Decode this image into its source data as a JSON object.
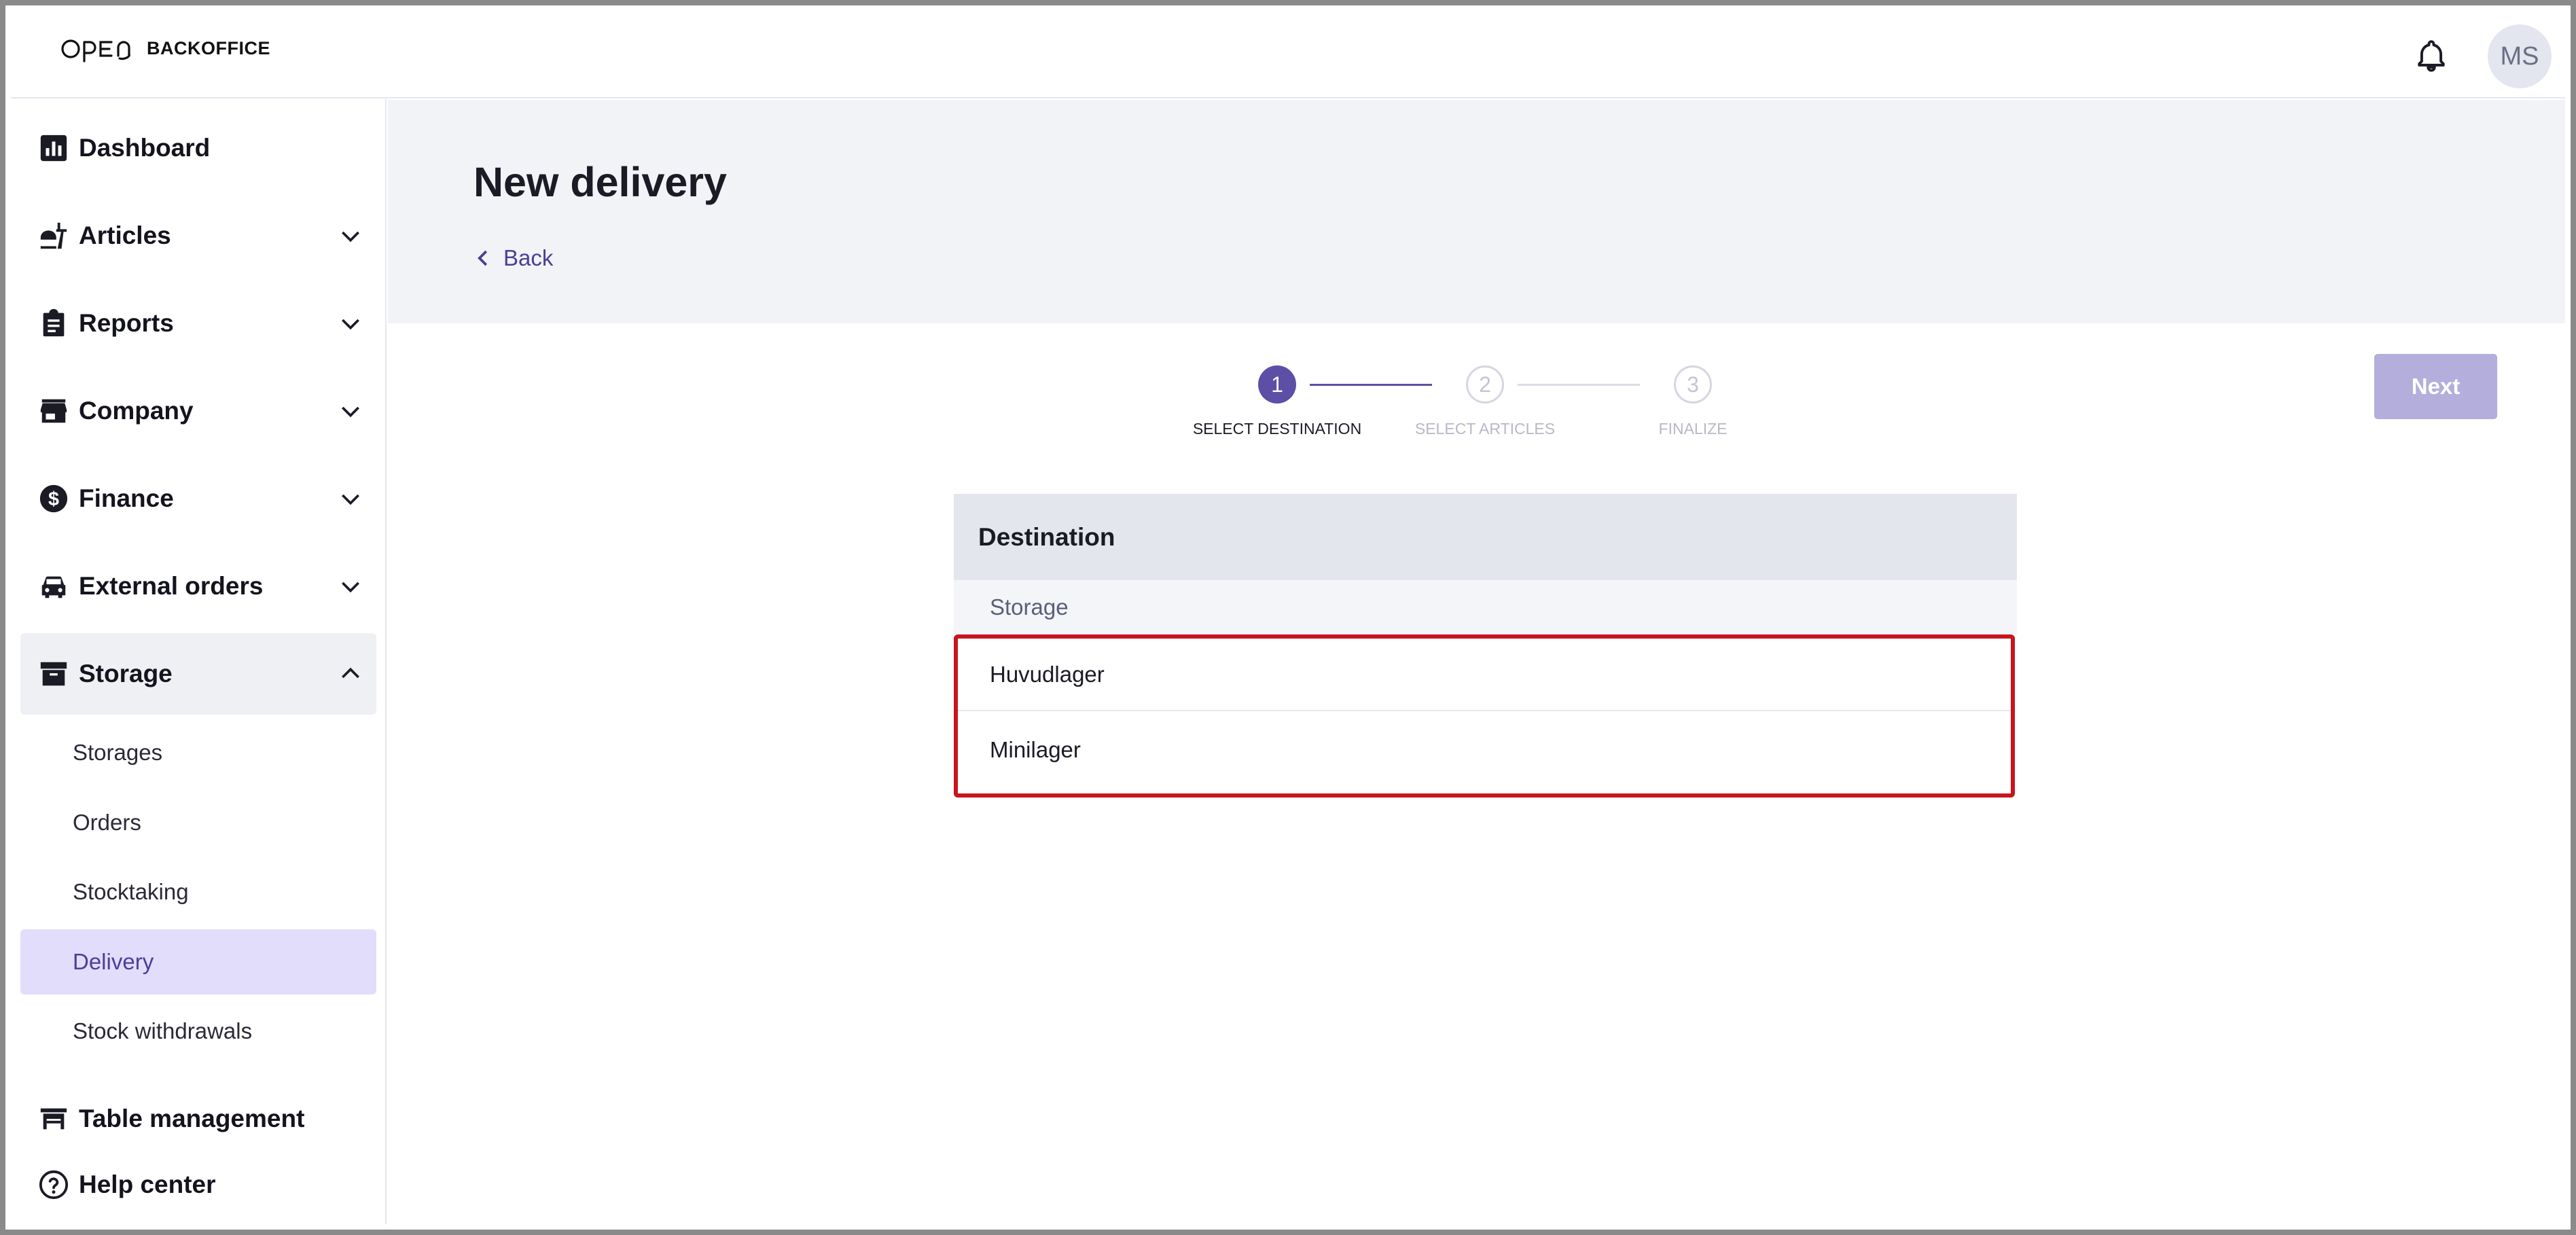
{
  "header": {
    "logo_text": "BACKOFFICE",
    "user_initials": "MS"
  },
  "sidebar": {
    "items": [
      {
        "label": "Dashboard",
        "icon": "chart-icon",
        "expandable": false
      },
      {
        "label": "Articles",
        "icon": "food-icon",
        "expandable": true
      },
      {
        "label": "Reports",
        "icon": "clipboard-icon",
        "expandable": true
      },
      {
        "label": "Company",
        "icon": "store-icon",
        "expandable": true
      },
      {
        "label": "Finance",
        "icon": "dollar-icon",
        "expandable": true
      },
      {
        "label": "External orders",
        "icon": "car-icon",
        "expandable": true
      },
      {
        "label": "Storage",
        "icon": "archive-icon",
        "expandable": true,
        "open": true
      },
      {
        "label": "Table management",
        "icon": "table-icon",
        "expandable": false
      },
      {
        "label": "Help center",
        "icon": "help-icon",
        "expandable": false
      }
    ],
    "storage_sub": [
      {
        "label": "Storages"
      },
      {
        "label": "Orders"
      },
      {
        "label": "Stocktaking"
      },
      {
        "label": "Delivery",
        "active": true
      },
      {
        "label": "Stock withdrawals"
      }
    ]
  },
  "main": {
    "title": "New delivery",
    "back_label": "Back",
    "next_label": "Next",
    "steps": [
      {
        "number": "1",
        "label": "SELECT DESTINATION",
        "state": "active"
      },
      {
        "number": "2",
        "label": "SELECT ARTICLES",
        "state": "pending"
      },
      {
        "number": "3",
        "label": "FINALIZE",
        "state": "pending"
      }
    ],
    "destination": {
      "heading": "Destination",
      "group_label": "Storage",
      "options": [
        "Huvudlager",
        "Minilager"
      ]
    }
  },
  "colors": {
    "accent": "#5d4fa6",
    "active_bg": "#e2ddfb",
    "next_disabled": "#b3aedb",
    "highlight_border": "#c8141c"
  }
}
